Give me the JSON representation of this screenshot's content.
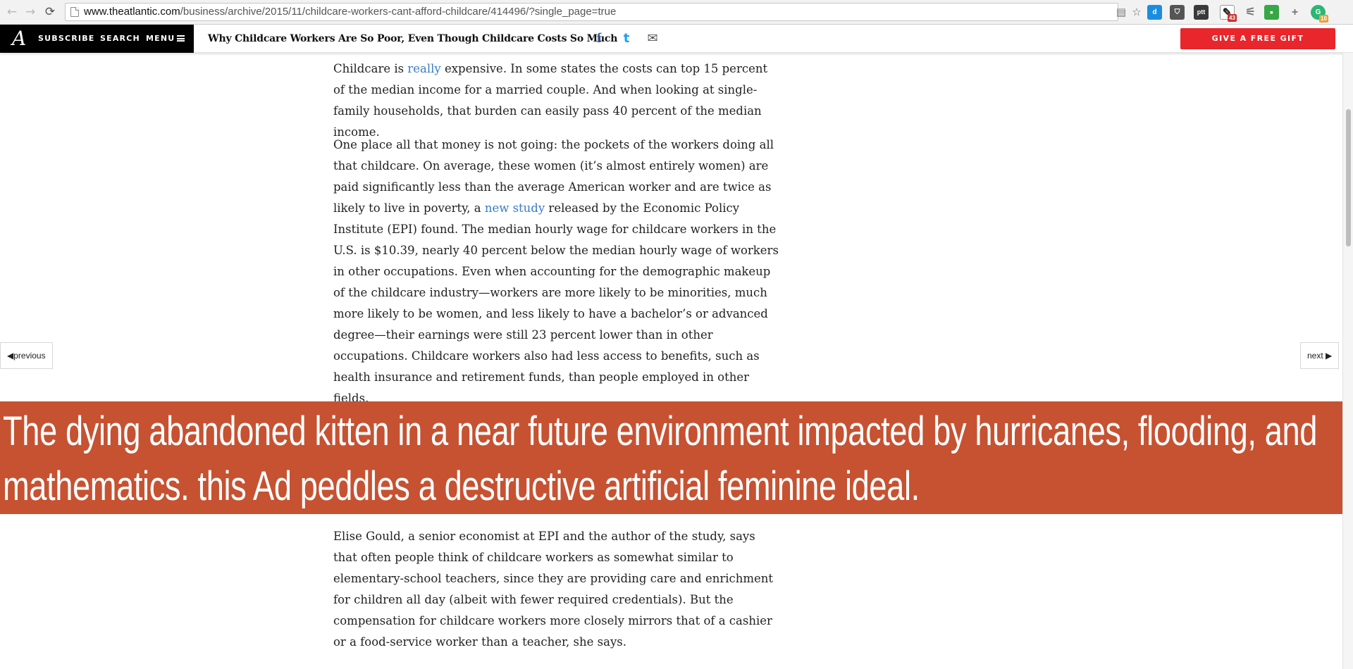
{
  "browser": {
    "url_host": "www.theatlantic.com",
    "url_path": "/business/archive/2015/11/childcare-workers-cant-afford-childcare/414496/?single_page=true",
    "back_glyph": "←",
    "forward_glyph": "→",
    "reload_glyph": "⟳",
    "extensions": [
      {
        "icon": "readability-icon",
        "glyph": "d",
        "color": "#1b8de0"
      },
      {
        "icon": "pocket-icon",
        "glyph": "⛉",
        "color": "#555555"
      },
      {
        "icon": "ptt-icon",
        "glyph": "ptt",
        "color": "#3a3a3a"
      },
      {
        "icon": "pencil-icon",
        "glyph": "✎",
        "color": "#222222",
        "badge": "43"
      },
      {
        "icon": "antenna-icon",
        "glyph": "⚟",
        "color": "#777777"
      },
      {
        "icon": "green-square-icon",
        "glyph": "▪",
        "color": "#38a745"
      },
      {
        "icon": "plus-icon",
        "glyph": "+",
        "color": "#888888"
      },
      {
        "icon": "grammarly-icon",
        "glyph": "G",
        "color": "#2bb673",
        "badge": "10"
      }
    ]
  },
  "site": {
    "logo": "A",
    "subscribe": "SUBSCRIBE",
    "search": "SEARCH",
    "menu": "MENU",
    "headline": "Why Childcare Workers Are So Poor, Even Though Childcare Costs So Much",
    "social": {
      "facebook": "f",
      "twitter": "t",
      "email": "✉"
    },
    "gift": "GIVE A FREE GIFT",
    "colors": {
      "gift": "#e8262b",
      "facebook": "#3b5998",
      "twitter": "#1da1f2",
      "link": "#3b7bc4",
      "banner": "#c65232"
    }
  },
  "article": {
    "p1": {
      "before": "Childcare is ",
      "link": "really",
      "after": " expensive. In some states the costs can top 15 percent of the median income for a married couple. And when looking at single-family households, that burden can easily pass 40 percent of the median income."
    },
    "p2": {
      "before": "One place all that money is not going: the pockets of the workers doing all that childcare. On average, these women (it’s almost entirely women) are paid significantly less than the average American worker and are twice as likely to live in poverty, a ",
      "link": "new study",
      "after": " released by the Economic Policy Institute (EPI) found. The median hourly wage for childcare workers in the U.S. is $10.39, nearly 40 percent below the median hourly wage of workers in other occupations. Even when accounting for the demographic makeup of the childcare industry—workers are more likely to be minorities, much more likely to be women, and less likely to have a bachelor’s or advanced degree—their earnings were still 23 percent lower than in other occupations. Childcare workers also had less access to benefits, such as health insurance and retirement funds, than people employed in other fields."
    },
    "p3": "Elise Gould, a senior economist at EPI and the author of the study, says that often people think of childcare workers as somewhat similar to elementary-school teachers, since they are providing care and enrichment for children all day (albeit with fewer required credentials). But the compensation for childcare workers more closely mirrors that of a cashier or a food-service worker than a teacher, she says."
  },
  "pager": {
    "previous": "previous",
    "next": "next"
  },
  "banner": "The dying abandoned kitten in a near future environment impacted by hurricanes, flooding, and mathematics. this Ad peddles a destructive artificial feminine ideal."
}
